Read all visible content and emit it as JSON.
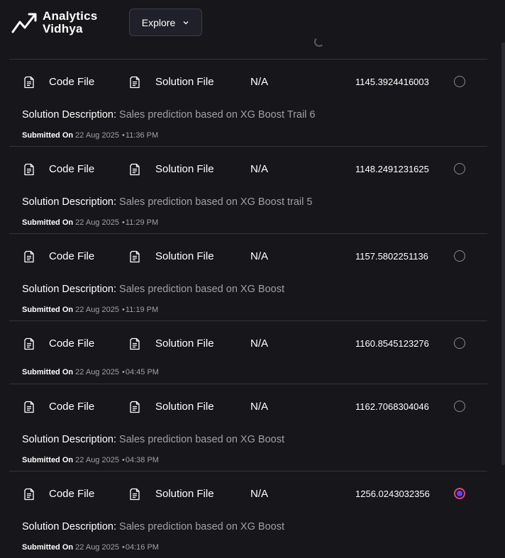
{
  "brand": {
    "line1": "Analytics",
    "line2": "Vidhya"
  },
  "nav": {
    "explore_label": "Explore"
  },
  "submissions": [
    {
      "code_label": "Code File",
      "solution_label": "Solution File",
      "na": "N/A",
      "score": "1145.3924416003",
      "selected": false,
      "desc_label": "Solution Description:",
      "desc_value": "Sales prediction based on XG Boost Trail 6",
      "submitted_label": "Submitted On",
      "date": "22 Aug 2025",
      "time": "11:36 PM"
    },
    {
      "code_label": "Code File",
      "solution_label": "Solution File",
      "na": "N/A",
      "score": "1148.2491231625",
      "selected": false,
      "desc_label": "Solution Description:",
      "desc_value": "Sales prediction based on XG Boost trail 5",
      "submitted_label": "Submitted On",
      "date": "22 Aug 2025",
      "time": "11:29 PM"
    },
    {
      "code_label": "Code File",
      "solution_label": "Solution File",
      "na": "N/A",
      "score": "1157.5802251136",
      "selected": false,
      "desc_label": "Solution Description:",
      "desc_value": "Sales prediction based on XG Boost",
      "submitted_label": "Submitted On",
      "date": "22 Aug 2025",
      "time": "11:19 PM"
    },
    {
      "code_label": "Code File",
      "solution_label": "Solution File",
      "na": "N/A",
      "score": "1160.8545123276",
      "selected": false,
      "submitted_label": "Submitted On",
      "date": "22 Aug 2025",
      "time": "04:45 PM"
    },
    {
      "code_label": "Code File",
      "solution_label": "Solution File",
      "na": "N/A",
      "score": "1162.7068304046",
      "selected": false,
      "desc_label": "Solution Description:",
      "desc_value": "Sales prediction based on XG Boost",
      "submitted_label": "Submitted On",
      "date": "22 Aug 2025",
      "time": "04:38 PM"
    },
    {
      "code_label": "Code File",
      "solution_label": "Solution File",
      "na": "N/A",
      "score": "1256.0243032356",
      "selected": true,
      "desc_label": "Solution Description:",
      "desc_value": "Sales prediction based on XG Boost",
      "submitted_label": "Submitted On",
      "date": "22 Aug 2025",
      "time": "04:16 PM"
    }
  ],
  "colors": {
    "background": "#17161a",
    "selected_radio_ring": "#e0457b",
    "selected_radio_dot": "#6a3cff"
  },
  "icons": {
    "file": "file-document-icon",
    "logo": "analytics-vidhya-logo",
    "dropdown": "chevron-down-icon"
  }
}
